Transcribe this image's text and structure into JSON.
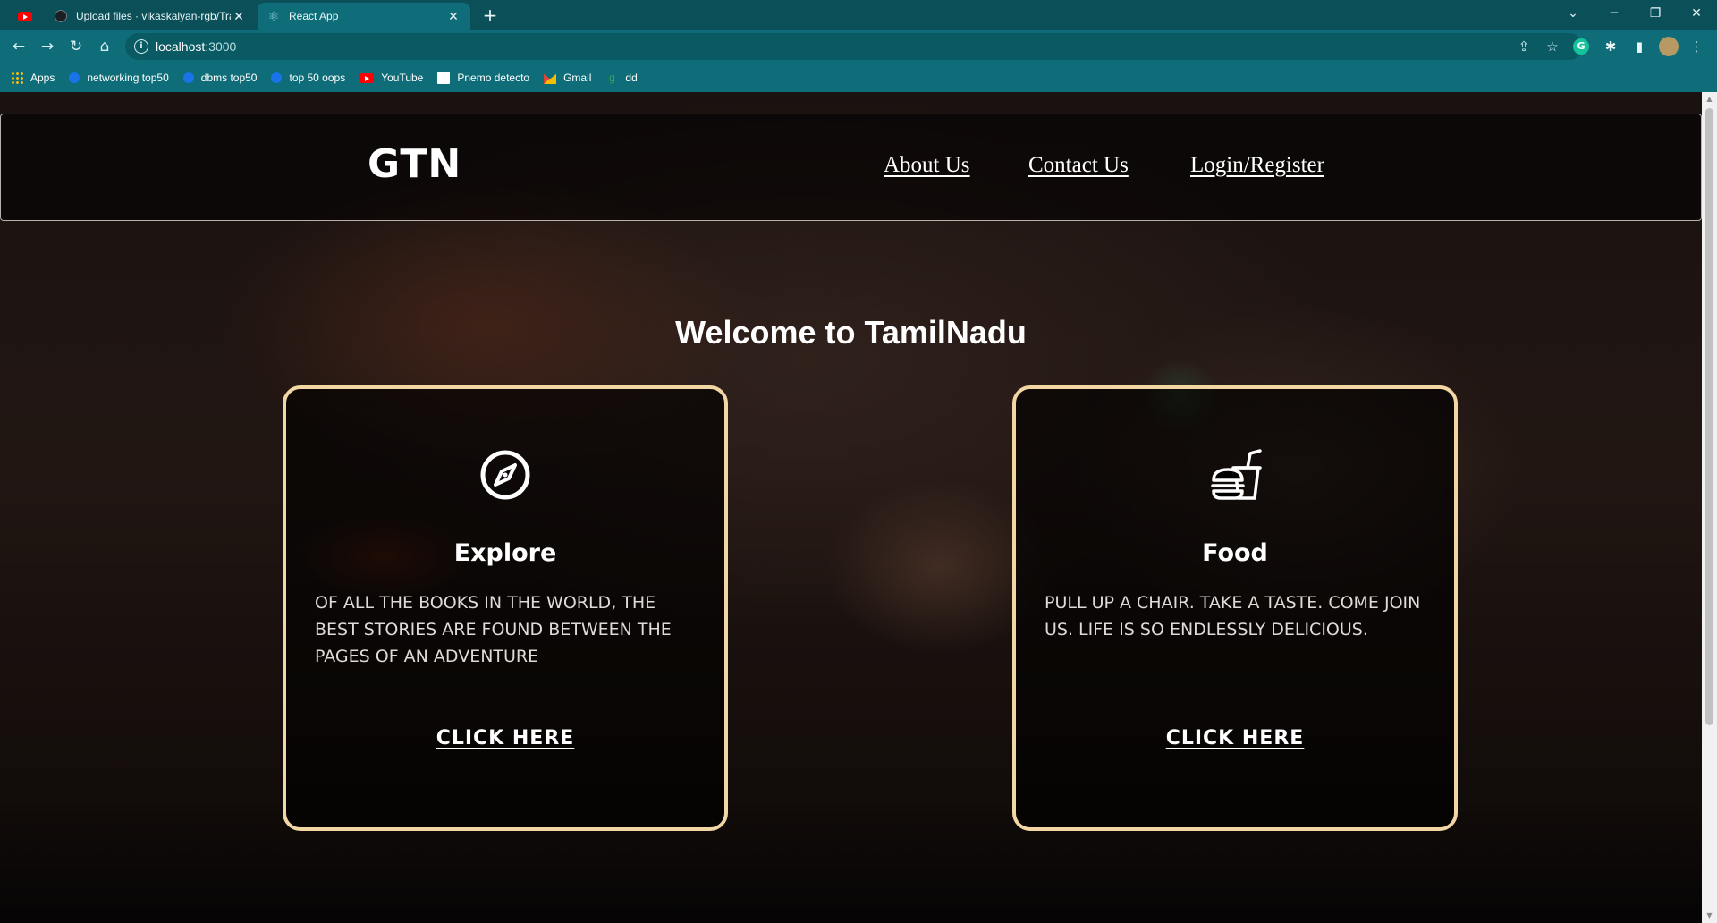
{
  "browser": {
    "tabs": [
      {
        "title": "",
        "icon": "youtube-icon"
      },
      {
        "title": "Upload files · vikaskalyan-rgb/Tra",
        "icon": "github-icon"
      },
      {
        "title": "React App",
        "icon": "react-icon"
      }
    ],
    "url_host": "localhost",
    "url_port": ":3000",
    "bookmarks": [
      {
        "label": "Apps",
        "icon": "apps-grid-icon"
      },
      {
        "label": "networking top50",
        "icon": "globe-icon"
      },
      {
        "label": "dbms top50",
        "icon": "globe-icon"
      },
      {
        "label": "top 50 oops",
        "icon": "globe-icon"
      },
      {
        "label": "YouTube",
        "icon": "youtube-icon"
      },
      {
        "label": "Pnemo detecto",
        "icon": "document-icon"
      },
      {
        "label": "Gmail",
        "icon": "gmail-icon"
      },
      {
        "label": "dd",
        "icon": "grammarly-icon"
      }
    ]
  },
  "page": {
    "logo": "GTN",
    "nav": {
      "about": "About Us",
      "contact": "Contact Us",
      "login": "Login/Register"
    },
    "welcome": "Welcome to TamilNadu",
    "cards": [
      {
        "title": "Explore",
        "icon": "compass-icon",
        "description": "OF ALL THE BOOKS IN THE WORLD, THE BEST STORIES ARE FOUND BETWEEN THE PAGES OF AN ADVENTURE",
        "cta": "CLICK HERE"
      },
      {
        "title": "Food",
        "icon": "burger-drink-icon",
        "description": "PULL UP A CHAIR. TAKE A TASTE. COME JOIN US. LIFE IS SO ENDLESSLY DELICIOUS.",
        "cta": "CLICK HERE"
      }
    ]
  },
  "colors": {
    "chrome": "#0e6d78",
    "tabstrip": "#0b4f59",
    "card_border": "#f2d6a4"
  }
}
